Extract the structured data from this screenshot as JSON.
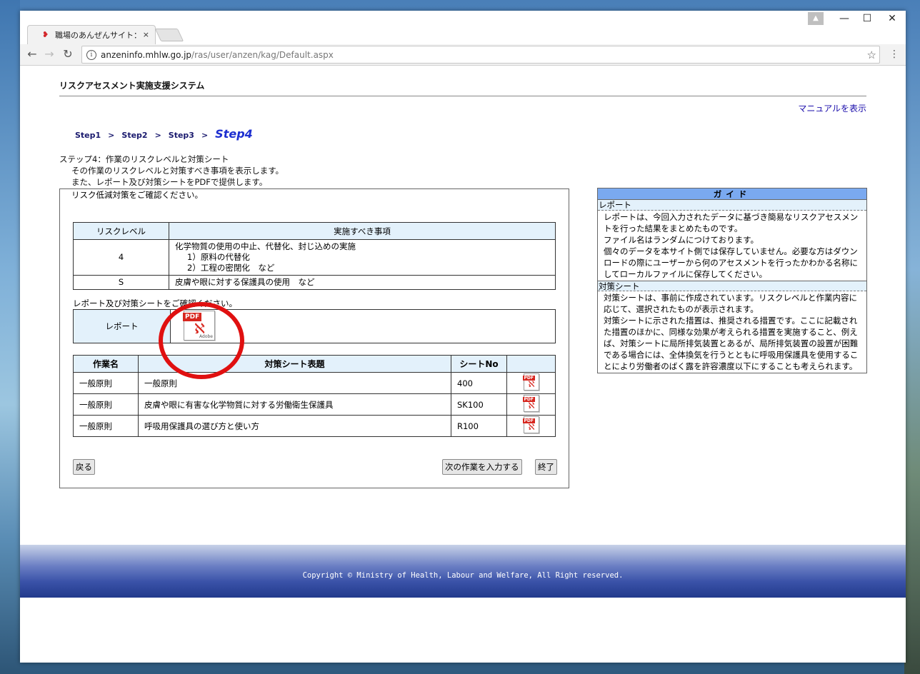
{
  "browser": {
    "tab_title": "職場のあんぜんサイト：化学",
    "tab_close": "×",
    "url_host": "anzeninfo.mhlw.go.jp",
    "url_path": "/ras/user/anzen/kag/Default.aspx"
  },
  "header": {
    "system_title": "リスクアセスメント実施支援システム",
    "manual_link": "マニュアルを表示"
  },
  "steps": {
    "items": [
      "Step1",
      "Step2",
      "Step3"
    ],
    "separator": ">",
    "current": "Step4"
  },
  "intro": {
    "line1": "ステップ4：作業のリスクレベルと対策シート",
    "line2": "その作業のリスクレベルと対策すべき事項を表示します。",
    "line3": "また、レポート及び対策シートをPDFで提供します。",
    "line4": "リスク低減対策をご確認ください。"
  },
  "risk_table": {
    "headers": [
      "リスクレベル",
      "実施すべき事項"
    ],
    "rows": [
      {
        "level": "4",
        "lines": [
          "化学物質の使用の中止、代替化、封じ込めの実施",
          "1）原料の代替化",
          "2）工程の密閉化　など"
        ]
      },
      {
        "level": "S",
        "lines": [
          "皮膚や眼に対する保護具の使用　など"
        ]
      }
    ]
  },
  "report": {
    "caption": "レポート及び対策シートをご確認ください。",
    "label": "レポート",
    "icon": "pdf-icon"
  },
  "sheet_table": {
    "headers": [
      "作業名",
      "対策シート表題",
      "シートNo",
      ""
    ],
    "rows": [
      {
        "task": "一般原則",
        "title": "一般原則",
        "no": "400"
      },
      {
        "task": "一般原則",
        "title": "皮膚や眼に有害な化学物質に対する労働衛生保護具",
        "no": "SK100"
      },
      {
        "task": "一般原則",
        "title": "呼吸用保護具の選び方と使い方",
        "no": "R100"
      }
    ]
  },
  "buttons": {
    "back": "戻る",
    "next": "次の作業を入力する",
    "end": "終了"
  },
  "guide": {
    "title": "ガイド",
    "sections": [
      {
        "heading": "レポート",
        "lines": [
          "レポートは、今回入力されたデータに基づき簡易なリスクアセスメントを行った結果をまとめたものです。",
          "ファイル名はランダムにつけております。",
          "個々のデータを本サイト側では保存していません。必要な方はダウンロードの際にユーザーから何のアセスメントを行ったかわかる名称にしてローカルファイルに保存してください。"
        ]
      },
      {
        "heading": "対策シート",
        "lines": [
          "対策シートは、事前に作成されています。リスクレベルと作業内容に応じて、選択されたものが表示されます。",
          "対策シートに示された措置は、推奨される措置です。ここに記載された措置のほかに、同様な効果が考えられる措置を実施すること、例えば、対策シートに局所排気装置とあるが、局所排気装置の設置が困難である場合には、全体換気を行うとともに呼吸用保護具を使用することにより労働者のばく露を許容濃度以下にすることも考えられます。"
        ]
      }
    ]
  },
  "footer": {
    "copyright": "Copyright © Ministry of Health, Labour and Welfare, All Right reserved."
  },
  "colors": {
    "header_cell_bg": "#e3f1fb",
    "guide_title_bg": "#7aa9f0",
    "highlight_circle": "#e01010",
    "step_current": "#1d2fd0"
  }
}
